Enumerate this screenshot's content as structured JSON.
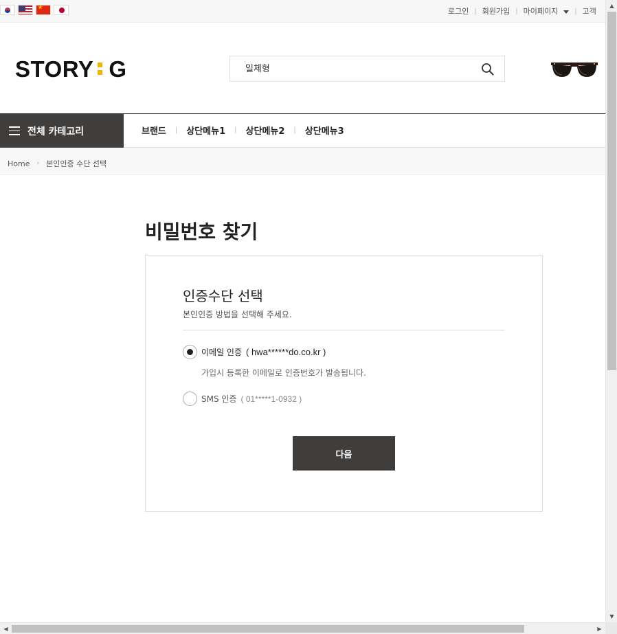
{
  "topbar": {
    "flags": [
      "flag-kr-icon",
      "flag-us-icon",
      "flag-cn-icon",
      "flag-jp-icon"
    ],
    "links": {
      "login": "로그인",
      "signup": "회원가입",
      "mypage": "마이페이지",
      "customer": "고객"
    }
  },
  "header": {
    "logo_left": "STORY",
    "logo_right": "G",
    "logo_accent": "#f5b400",
    "search": {
      "value": "일체형",
      "icon": "search-icon"
    },
    "banner_icon": "sunglasses-icon"
  },
  "nav": {
    "all_categories": "전체 카테고리",
    "menu": [
      "브랜드",
      "상단메뉴1",
      "상단메뉴2",
      "상단메뉴3"
    ]
  },
  "breadcrumb": {
    "home": "Home",
    "current": "본인인증 수단 선택"
  },
  "main": {
    "title": "비밀번호 찾기",
    "panel": {
      "heading": "인증수단 선택",
      "subheading": "본인인증 방법을 선택해 주세요.",
      "options": [
        {
          "label": "이메일 인증",
          "detail": "( hwa******do.co.kr )",
          "checked": true,
          "help": "가입시 등록한 이메일로 인증번호가 발송됩니다."
        },
        {
          "label": "SMS 인증",
          "detail": "( 01*****1-0932 )",
          "checked": false
        }
      ],
      "next_button": "다음"
    }
  },
  "colors": {
    "dark": "#3f3e3c",
    "accent": "#f5b400"
  }
}
